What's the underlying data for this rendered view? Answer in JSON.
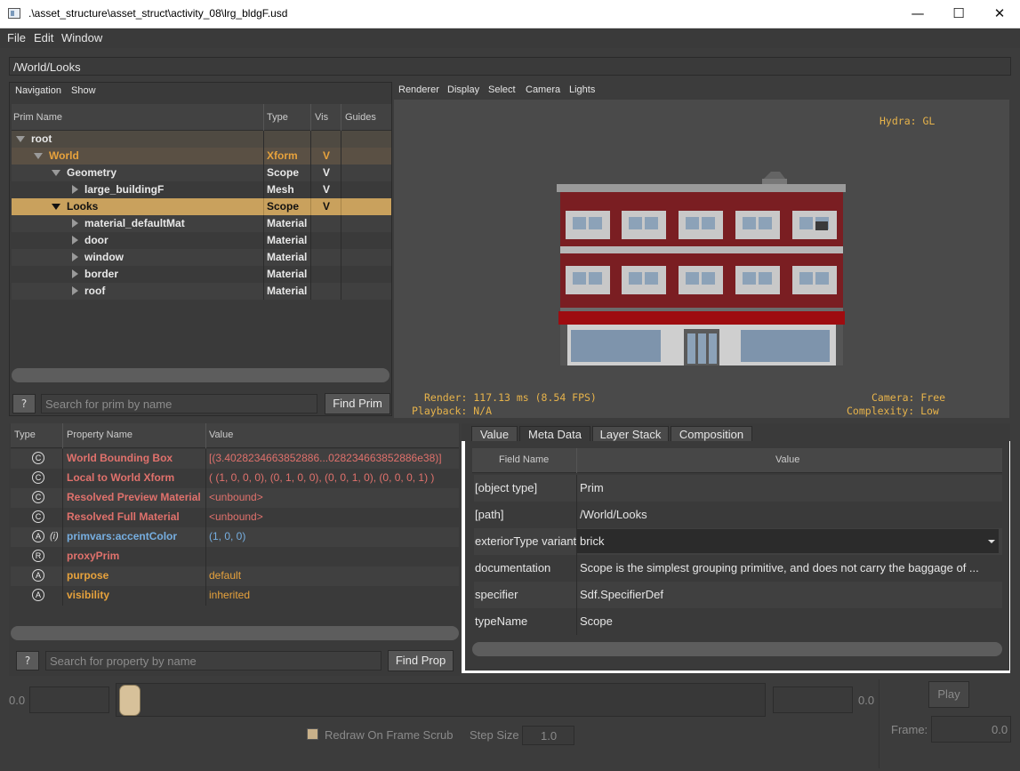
{
  "window": {
    "title": ".\\asset_structure\\asset_struct\\activity_08\\lrg_bldgF.usd",
    "min": "—",
    "max": "☐",
    "close": "✕"
  },
  "menu": [
    "File",
    "Edit",
    "Window"
  ],
  "path": "/World/Looks",
  "prim_panel": {
    "menu": [
      "Navigation",
      "Show"
    ],
    "headers": [
      "Prim Name",
      "Type",
      "Vis",
      "Guides"
    ],
    "rows": [
      {
        "name": "root",
        "type": "",
        "vis": ""
      },
      {
        "name": "World",
        "type": "Xform",
        "vis": "V"
      },
      {
        "name": "Geometry",
        "type": "Scope",
        "vis": "V"
      },
      {
        "name": "large_buildingF",
        "type": "Mesh",
        "vis": "V"
      },
      {
        "name": "Looks",
        "type": "Scope",
        "vis": "V"
      },
      {
        "name": "material_defaultMat",
        "type": "Material",
        "vis": ""
      },
      {
        "name": "door",
        "type": "Material",
        "vis": ""
      },
      {
        "name": "window",
        "type": "Material",
        "vis": ""
      },
      {
        "name": "border",
        "type": "Material",
        "vis": ""
      },
      {
        "name": "roof",
        "type": "Material",
        "vis": ""
      }
    ],
    "help": "?",
    "search_placeholder": "Search for prim by name",
    "find_button": "Find Prim"
  },
  "viewport": {
    "menu": [
      "Renderer",
      "Display",
      "Select",
      "Camera",
      "Lights"
    ],
    "hydra": "Hydra: GL",
    "render": "Render: 117.13 ms (8.54 FPS)",
    "playback": "Playback: N/A",
    "camera": "Camera: Free",
    "complexity": "Complexity: Low",
    "colors": {
      "brick": "#7a1e22",
      "trim": "#c8c8c8",
      "awning": "#9e0c10",
      "hud": "#e7b34a"
    }
  },
  "property_panel": {
    "headers": [
      "Type",
      "Property Name",
      "Value"
    ],
    "rows": [
      {
        "badge": "C",
        "extra": "",
        "name": "World Bounding Box",
        "value": "[(3.4028234663852886...028234663852886e38)]",
        "kind": "computed"
      },
      {
        "badge": "C",
        "extra": "",
        "name": "Local to World Xform",
        "value": "( (1, 0, 0, 0), (0, 1, 0, 0), (0, 0, 1, 0), (0, 0, 0, 1) )",
        "kind": "computed"
      },
      {
        "badge": "C",
        "extra": "",
        "name": "Resolved Preview Material",
        "value": "<unbound>",
        "kind": "computed"
      },
      {
        "badge": "C",
        "extra": "",
        "name": "Resolved Full Material",
        "value": "<unbound>",
        "kind": "computed"
      },
      {
        "badge": "A",
        "extra": "(i)",
        "name": "primvars:accentColor",
        "value": "(1, 0, 0)",
        "kind": "inherited"
      },
      {
        "badge": "R",
        "extra": "",
        "name": "proxyPrim",
        "value": "",
        "kind": "rel"
      },
      {
        "badge": "A",
        "extra": "",
        "name": "purpose",
        "value": "default",
        "kind": "attr"
      },
      {
        "badge": "A",
        "extra": "",
        "name": "visibility",
        "value": "inherited",
        "kind": "attr"
      }
    ],
    "help": "?",
    "search_placeholder": "Search for property by name",
    "find_button": "Find Prop"
  },
  "metadata": {
    "tabs": [
      "Value",
      "Meta Data",
      "Layer Stack",
      "Composition"
    ],
    "headers": [
      "Field Name",
      "Value"
    ],
    "rows": [
      {
        "field": "[object type]",
        "value": "Prim"
      },
      {
        "field": "[path]",
        "value": "/World/Looks"
      },
      {
        "field": "exteriorType variant",
        "value": "brick"
      },
      {
        "field": "documentation",
        "value": "Scope is the simplest grouping primitive, and does not carry the baggage of ..."
      },
      {
        "field": "specifier",
        "value": "Sdf.SpecifierDef"
      },
      {
        "field": "typeName",
        "value": "Scope"
      }
    ]
  },
  "timeline": {
    "start": "0.0",
    "end": "0.0",
    "redraw_label": "Redraw On Frame Scrub",
    "step_label": "Step Size",
    "step_value": "1.0",
    "play": "Play",
    "frame_label": "Frame:",
    "frame_value": "0.0"
  }
}
